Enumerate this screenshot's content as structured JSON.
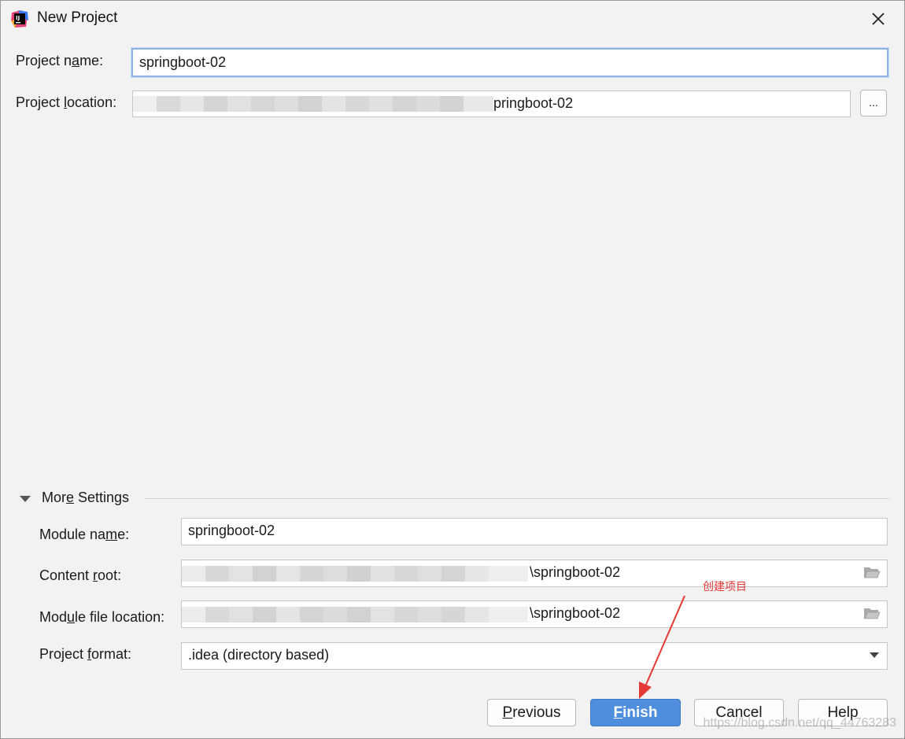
{
  "window": {
    "title": "New Project",
    "icon": "intellij-idea-icon",
    "close_icon": "close-icon"
  },
  "form": {
    "project_name": {
      "label_pre": "Project n",
      "label_ul": "a",
      "label_post": "me:",
      "value": "springboot-02"
    },
    "project_location": {
      "label_pre": "Project ",
      "label_ul": "l",
      "label_post": "ocation:",
      "value_visible": "pringboot-02",
      "browse_label": "..."
    }
  },
  "more_settings": {
    "label_pre": "Mor",
    "label_ul": "e",
    "label_post": " Settings",
    "module_name": {
      "label_pre": "Module na",
      "label_ul": "m",
      "label_post": "e:",
      "value": "springboot-02"
    },
    "content_root": {
      "label_pre": "Content ",
      "label_ul": "r",
      "label_post": "oot:",
      "value_visible": "\\springboot-02"
    },
    "module_file_location": {
      "label_pre": "Mod",
      "label_ul": "u",
      "label_post": "le file location:",
      "value_visible": "\\springboot-02"
    },
    "project_format": {
      "label_pre": "Project ",
      "label_ul": "f",
      "label_post": "ormat:",
      "value": ".idea (directory based)"
    }
  },
  "buttons": {
    "previous": {
      "ul": "P",
      "rest": "revious"
    },
    "finish": {
      "ul": "F",
      "rest": "inish"
    },
    "cancel": "Cancel",
    "help": "Help"
  },
  "annotation": {
    "text": "创建项目",
    "color": "#e53935"
  },
  "watermark": "https://blog.csdn.net/qq_44763283",
  "colors": {
    "accent": "#4f8edc",
    "focus_border": "#8db4e4",
    "background": "#f2f2f2"
  }
}
